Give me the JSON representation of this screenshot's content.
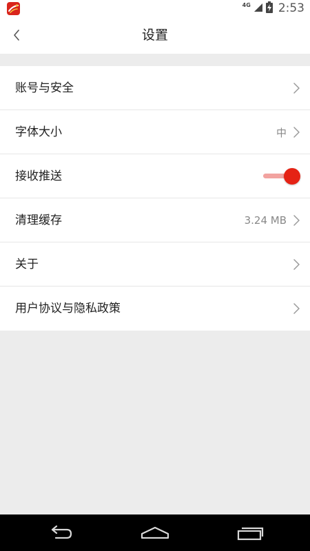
{
  "status_bar": {
    "network_label": "4G",
    "time": "2:53"
  },
  "header": {
    "title": "设置"
  },
  "settings": {
    "items": [
      {
        "label": "账号与安全",
        "value": ""
      },
      {
        "label": "字体大小",
        "value": "中"
      },
      {
        "label": "接收推送",
        "value": "",
        "toggle_on": true
      },
      {
        "label": "清理缓存",
        "value": "3.24 MB"
      },
      {
        "label": "关于",
        "value": ""
      },
      {
        "label": "用户协议与隐私政策",
        "value": ""
      }
    ]
  },
  "colors": {
    "accent": "#e52315",
    "accent_light": "#f2a3a0",
    "background": "#ececec"
  }
}
